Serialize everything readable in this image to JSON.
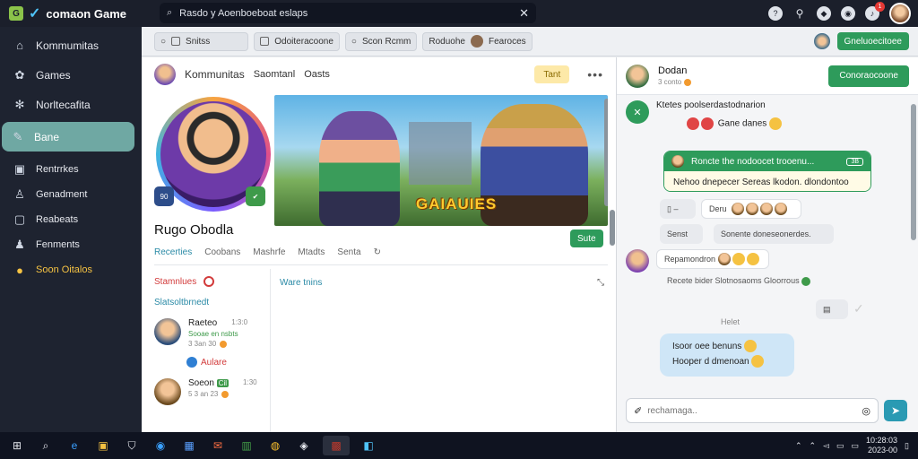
{
  "app": {
    "brand": "comaon Game",
    "logo_letter": "G"
  },
  "search": {
    "value": "Rasdo y Aoenboeboat eslaps"
  },
  "top_icons": [
    "help-icon",
    "pin-icon",
    "gamepad-icon",
    "globe-icon",
    "bell-icon"
  ],
  "notification_count": "1",
  "sidebar": {
    "items": [
      {
        "label": "Kommumitas",
        "icon": "home-icon"
      },
      {
        "label": "Games",
        "icon": "controller-icon"
      },
      {
        "label": "Norltecafita",
        "icon": "gear-icon"
      },
      {
        "label": "Bane",
        "icon": "chat-icon",
        "active": true
      },
      {
        "label": "Rentrrkes",
        "icon": "screen-icon"
      },
      {
        "label": "Genadment",
        "icon": "person-icon"
      },
      {
        "label": "Reabeats",
        "icon": "box-icon"
      },
      {
        "label": "Fenments",
        "icon": "people-icon"
      },
      {
        "label": "Soon Oitalos",
        "icon": "coin-icon",
        "gold": true
      }
    ]
  },
  "toolbar": {
    "groups": [
      "Snitss",
      "Odoiteracoone",
      "Scon Rcmm",
      "Roduohe",
      "Fearoces"
    ],
    "button": "Gneluoecitoee"
  },
  "profile": {
    "tabs": [
      "Kommunitas",
      "Saomtanl",
      "Oasts"
    ],
    "pill": "Tant",
    "name": "Rugo Obodla",
    "follow_button": "Sute",
    "banner_title": "GAIAUIES",
    "badge_left": "90",
    "subtabs": [
      "Recerties",
      "Coobans",
      "Mashrfe",
      "Mtadts",
      "Senta"
    ],
    "activity_title": "Stamnlues",
    "link": "Slatsoltbrnedt",
    "friends": [
      {
        "name": "Raeteo",
        "time": "1:3:0",
        "status": "Sooae en nsbts",
        "sub": "3 3an 30"
      },
      {
        "name": "Soeon",
        "tag": "Cil",
        "time": "1:30",
        "status": "",
        "sub": "5 3 an 23"
      }
    ],
    "aurora": "Aulare",
    "section_title": "Ware tnins"
  },
  "chat": {
    "name": "Dodan",
    "sub": "3 conto",
    "header_button": "Conoraocoone",
    "messages": [
      {
        "text": "Ktetes poolserdastodnarion",
        "reactions": "Gane danes"
      },
      {
        "card_title": "Roncte the nodoocet trooenu...",
        "card_tag": "3B",
        "card_text": "Nehoo dnepecer Sereas lkodon. dlondontoo"
      },
      {
        "chip": "Deru"
      },
      {
        "chip": "Senst",
        "chip2": "Sonente doneseonerdes."
      },
      {
        "text": "Repamondron"
      },
      {
        "link": "Recete bider Slotnosaoms Gloorrous"
      },
      {
        "label": "Helet"
      },
      {
        "bubble": [
          "Isoor oee benuns",
          "Hooper d dmenoan"
        ]
      }
    ],
    "input_placeholder": "rechamaga.."
  },
  "taskbar": {
    "icons": [
      "windows-icon",
      "search-icon",
      "edge-icon",
      "explorer-icon",
      "shield-icon",
      "browser-icon",
      "store-icon",
      "mail-icon",
      "sheets-icon",
      "chrome-icon",
      "steam-icon",
      "media-icon",
      "app-icon"
    ],
    "time": "10:28:03",
    "date": "2023-00"
  },
  "colors": {
    "accent_green": "#2e9b5b",
    "sidebar_bg": "#1e2330",
    "active_item": "#6fa8a3",
    "link_blue": "#2a8aa6"
  }
}
